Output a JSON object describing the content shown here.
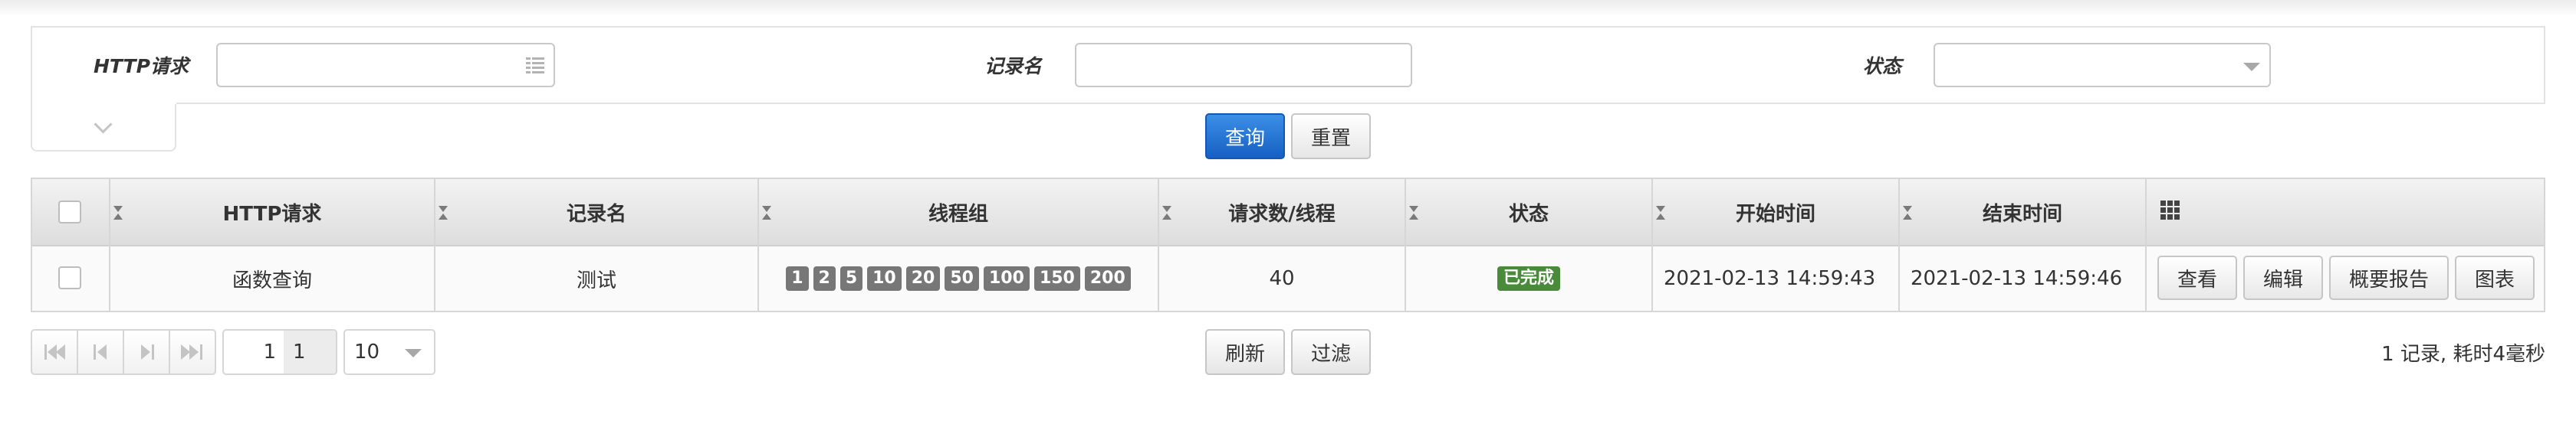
{
  "filters": {
    "http_label": "HTTP请求",
    "http_value": "",
    "record_label": "记录名",
    "record_value": "",
    "status_label": "状态",
    "status_value": ""
  },
  "actions": {
    "query": "查询",
    "reset": "重置"
  },
  "colors": {
    "primary": "#1f6fd2",
    "success": "#4a8a3b",
    "badge": "#777777"
  },
  "grid": {
    "columns": [
      "HTTP请求",
      "记录名",
      "线程组",
      "请求数/线程",
      "状态",
      "开始时间",
      "结束时间"
    ],
    "rows": [
      {
        "http": "函数查询",
        "record": "测试",
        "thread_groups": [
          "1",
          "2",
          "5",
          "10",
          "20",
          "50",
          "100",
          "150",
          "200"
        ],
        "requests_per_thread": "40",
        "status": "已完成",
        "start": "2021-02-13 14:59:43",
        "end": "2021-02-13 14:59:46",
        "actions": [
          "查看",
          "编辑",
          "概要报告",
          "图表"
        ]
      }
    ]
  },
  "pager": {
    "current_page": "1",
    "total_pages": "1",
    "page_size": "10",
    "refresh": "刷新",
    "filter": "过滤",
    "summary": "1 记录, 耗时4毫秒"
  }
}
